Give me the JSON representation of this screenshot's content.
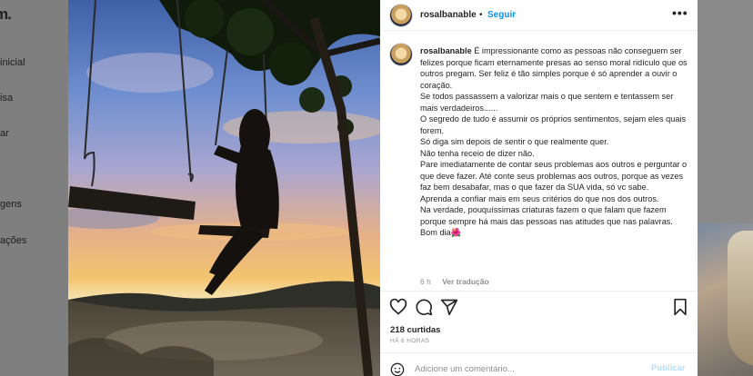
{
  "background": {
    "logo": "m.",
    "nav_items": [
      "inicial",
      "isa",
      "ar",
      "gens",
      "ações"
    ]
  },
  "post": {
    "username": "rosalbanable",
    "header_separator": "•",
    "follow_label": "Seguir",
    "more_label": "•••",
    "caption_lines": [
      "É impressionante como as pessoas não conseguem ser felizes porque ficam eternamente presas ao senso moral ridículo que os outros pregam. Ser feliz é tão simples porque é só aprender a ouvir o coração.",
      "Se todos passassem a valorizar mais o que sentem e tentassem ser mais verdadeiros......",
      "O segredo de tudo é assumir os próprios sentimentos, sejam eles quais forem.",
      "Só diga sim depois de sentir o que realmente quer.",
      "Não tenha receio de dizer não.",
      "Pare imediatamente de contar seus problemas aos outros e perguntar o que deve fazer. Até conte seus problemas aos outros, porque as vezes faz bem desabafar, mas o que fazer da SUA vida, só vc sabe.",
      "Aprenda a confiar mais em seus critérios do que nos dos outros.",
      "Na verdade, pouquíssimas criaturas fazem o que falam que fazem porque sempre há mais das pessoas nas atitudes que nas palavras.",
      "Bom dia🌺"
    ],
    "time_ago": "6 h",
    "reply_label": "Ver tradução",
    "likes": "218 curtidas",
    "timestamp": "HÁ 6 HORAS",
    "comment_placeholder": "Adicione um comentário...",
    "publish_label": "Publicar"
  }
}
